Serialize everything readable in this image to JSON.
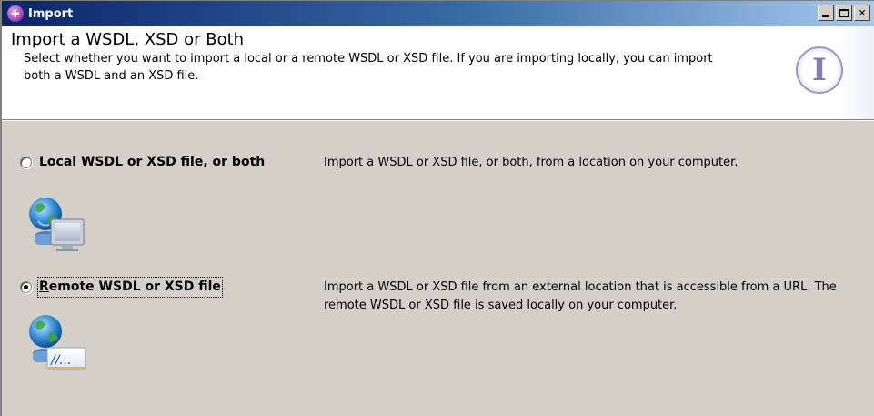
{
  "window": {
    "title": "Import",
    "title_icon": "import-wizard-icon",
    "controls": {
      "minimize": "minimize-icon",
      "maximize": "maximize-icon",
      "close_glyph": "✕"
    }
  },
  "header": {
    "title": "Import a WSDL, XSD or Both",
    "description": "Select whether you want to import a local or a remote WSDL or XSD file. If you are importing locally, you can import both a WSDL and an XSD file.",
    "logo_letter": "I"
  },
  "options": [
    {
      "label_mnemonic": "L",
      "label_rest": "ocal WSDL or XSD file, or both",
      "description": "Import a WSDL or XSD file, or both, from a location on your computer.",
      "selected": false,
      "icon": "local-computer-globe-icon"
    },
    {
      "label_mnemonic": "R",
      "label_rest": "emote WSDL or XSD file",
      "description": "Import a WSDL or XSD file from an external location that is accessible from a URL. The remote WSDL or XSD file is saved locally on your computer.",
      "selected": true,
      "icon": "remote-url-globe-icon",
      "url_badge": "//..."
    }
  ],
  "colors": {
    "dialog_bg": "#d4d0c8",
    "title_bar_start": "#0a246a",
    "title_bar_end": "#a6caf0",
    "header_bg": "#ffffff"
  }
}
